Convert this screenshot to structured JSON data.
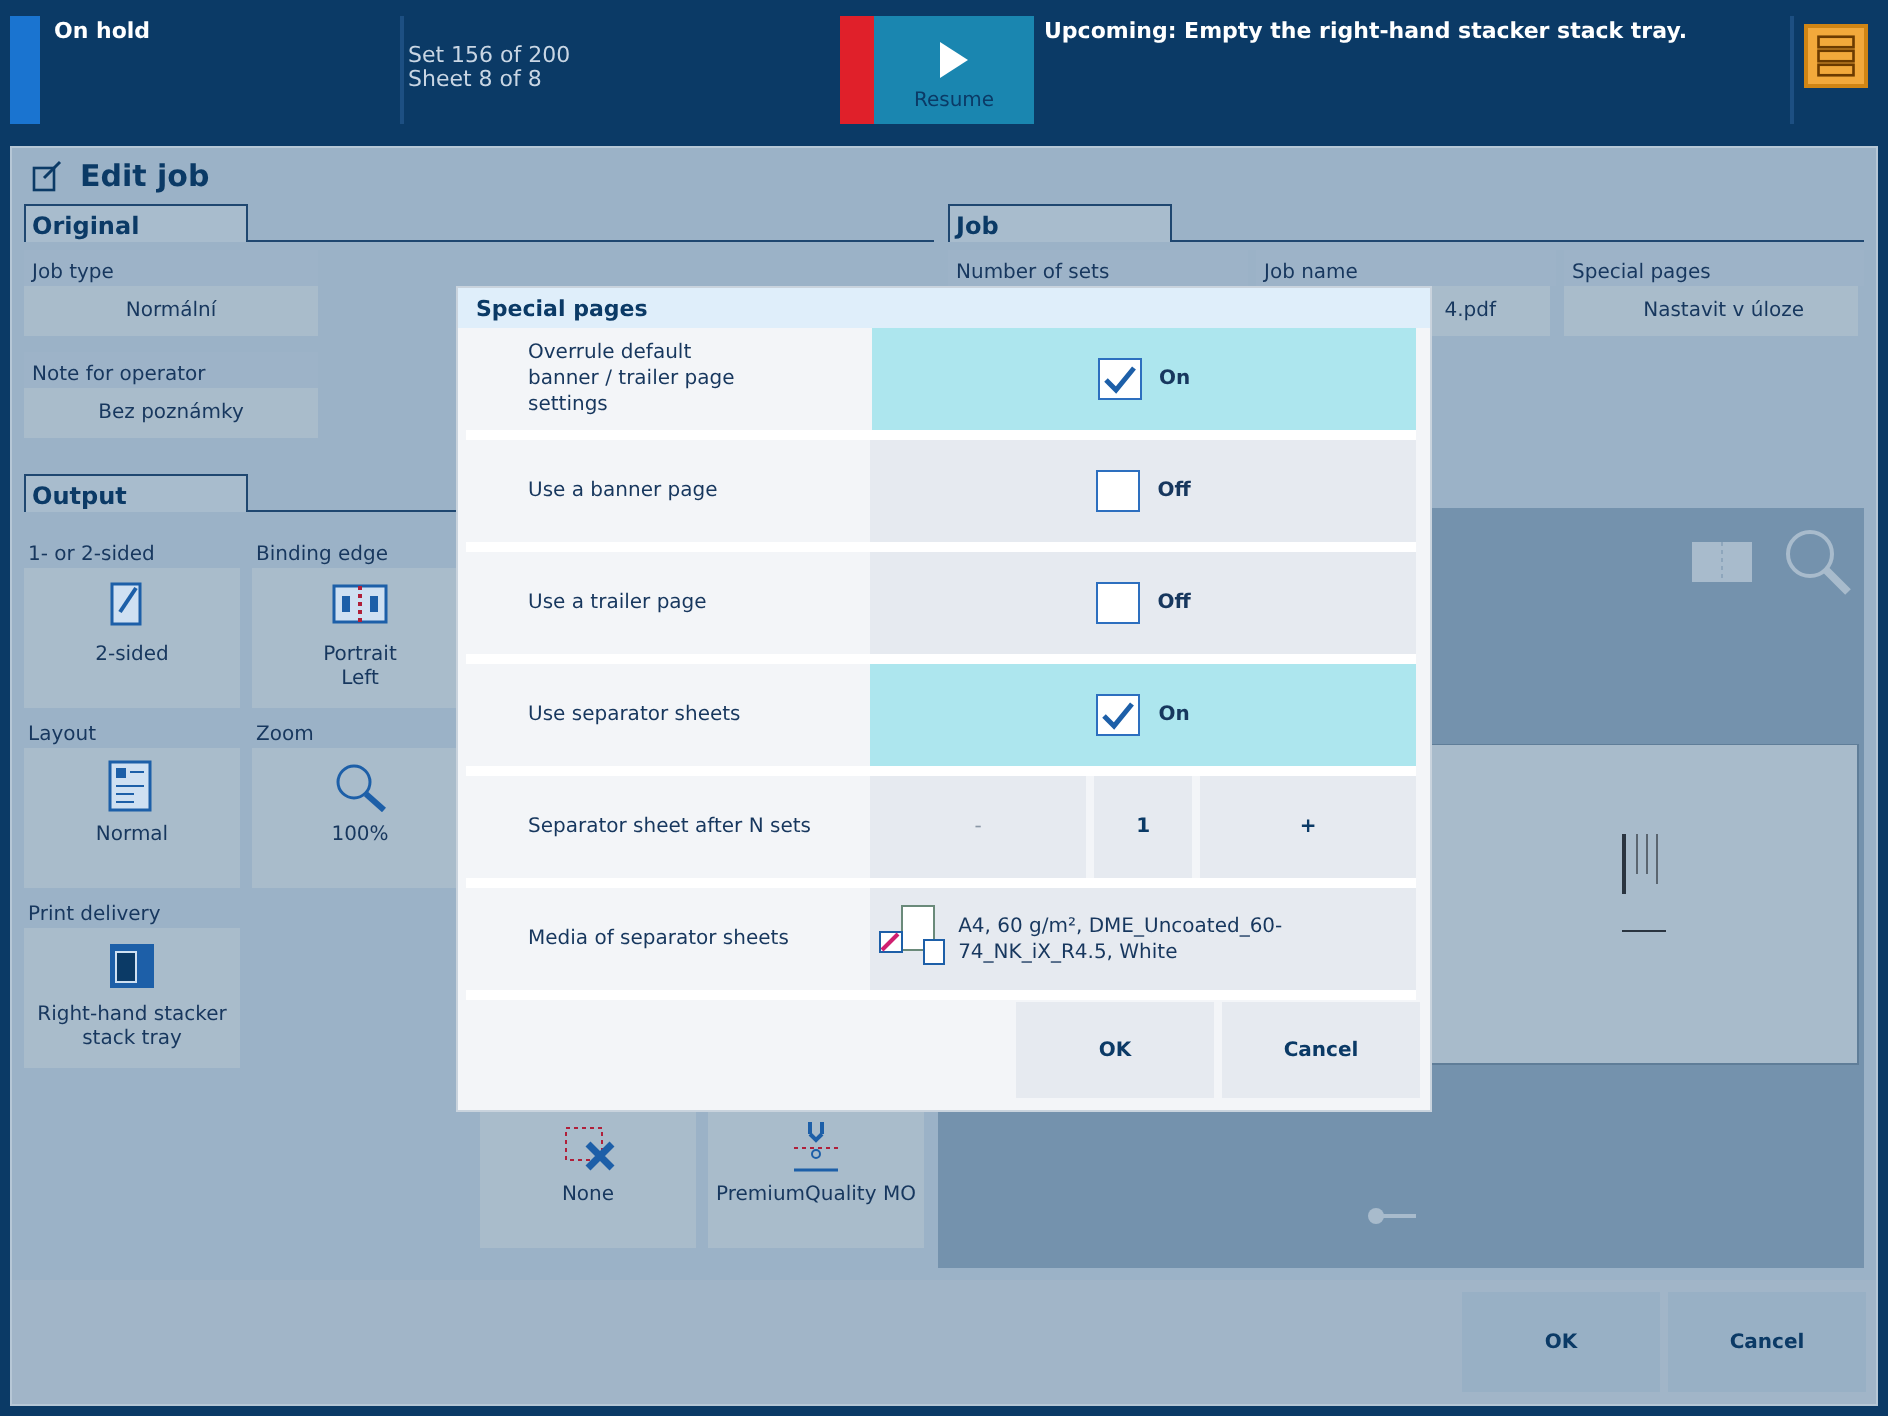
{
  "status": {
    "state": "On hold",
    "progress": [
      "Set 156 of 200",
      "Sheet 8 of 8"
    ],
    "resume_label": "Resume",
    "message": "Upcoming: Empty the right-hand stacker stack tray."
  },
  "title": "Edit job",
  "original": {
    "tab": "Original",
    "fields": [
      {
        "label": "Job type",
        "value": "Normální"
      },
      {
        "label": "Note for operator",
        "value": "Bez poznámky"
      }
    ]
  },
  "job": {
    "tab": "Job",
    "fields": [
      {
        "label": "Number of sets"
      },
      {
        "label": "Job name",
        "value": "4.pdf"
      },
      {
        "label": "Special pages",
        "value": "Nastavit v úloze"
      }
    ]
  },
  "output": {
    "tab": "Output",
    "tiles": [
      {
        "label": "1- or 2-sided",
        "value": [
          "2-sided"
        ],
        "kind": "duplex"
      },
      {
        "label": "Binding edge",
        "value": [
          "Portrait",
          "Left"
        ],
        "kind": "binding"
      },
      {
        "label": "Layout",
        "value": [
          "Normal"
        ],
        "kind": "layout"
      },
      {
        "label": "Zoom",
        "value": [
          "100%"
        ],
        "kind": "zoom"
      },
      {
        "label": "Print delivery",
        "value": [
          "Right-hand stacker",
          "stack tray"
        ],
        "kind": "stacker"
      }
    ],
    "lower_tiles": [
      {
        "value": [
          "None"
        ],
        "kind": "trim"
      },
      {
        "value": [
          "PremiumQuality MO"
        ],
        "kind": "printmode"
      }
    ]
  },
  "dialog": {
    "title": "Special pages",
    "rows": [
      {
        "kind": "toggle",
        "label": "Overrule default banner / trailer page settings",
        "checked": true,
        "state": "On"
      },
      {
        "kind": "toggle",
        "label": "Use a banner page",
        "checked": false,
        "state": "Off"
      },
      {
        "kind": "toggle",
        "label": "Use a trailer page",
        "checked": false,
        "state": "Off"
      },
      {
        "kind": "toggle",
        "label": "Use separator sheets",
        "checked": true,
        "state": "On"
      },
      {
        "kind": "stepper",
        "label": "Separator sheet after N sets",
        "minus": "-",
        "value": "1",
        "plus": "+"
      },
      {
        "kind": "media",
        "label": "Media of separator sheets",
        "value": "A4, 60 g/m², DME_Uncoated_60-74_NK_iX_R4.5, White"
      }
    ],
    "buttons": [
      "OK",
      "Cancel"
    ]
  },
  "preview": {
    "zoom_slider": {
      "level": 0
    }
  },
  "footer_buttons": [
    "OK",
    "Cancel"
  ]
}
